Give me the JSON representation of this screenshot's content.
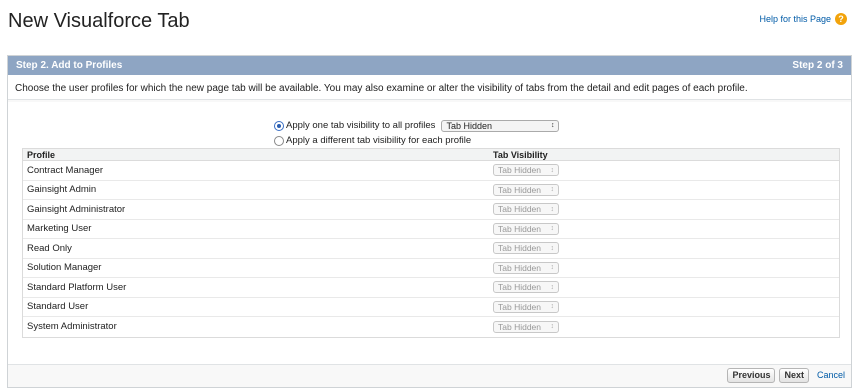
{
  "header": {
    "title": "New Visualforce Tab",
    "help_label": "Help for this Page",
    "help_icon": "?"
  },
  "step": {
    "title": "Step 2. Add to Profiles",
    "counter": "Step 2 of 3",
    "description": "Choose the user profiles for which the new page tab will be available. You may also examine or alter the visibility of tabs from the detail and edit pages of each profile."
  },
  "visibility": {
    "option_all_label": "Apply one tab visibility to all profiles",
    "option_each_label": "Apply a different tab visibility for each profile",
    "selected_option": "all",
    "all_select_value": "Tab Hidden"
  },
  "table": {
    "columns": [
      "Profile",
      "Tab Visibility"
    ],
    "rows": [
      {
        "profile": "Contract Manager",
        "visibility": "Tab Hidden"
      },
      {
        "profile": "Gainsight Admin",
        "visibility": "Tab Hidden"
      },
      {
        "profile": "Gainsight Administrator",
        "visibility": "Tab Hidden"
      },
      {
        "profile": "Marketing User",
        "visibility": "Tab Hidden"
      },
      {
        "profile": "Read Only",
        "visibility": "Tab Hidden"
      },
      {
        "profile": "Solution Manager",
        "visibility": "Tab Hidden"
      },
      {
        "profile": "Standard Platform User",
        "visibility": "Tab Hidden"
      },
      {
        "profile": "Standard User",
        "visibility": "Tab Hidden"
      },
      {
        "profile": "System Administrator",
        "visibility": "Tab Hidden"
      }
    ]
  },
  "footer": {
    "previous_label": "Previous",
    "next_label": "Next",
    "cancel_label": "Cancel"
  },
  "colors": {
    "header_bar": "#8ea5c3",
    "link": "#015ba7",
    "help_icon": "#f2a30b"
  }
}
